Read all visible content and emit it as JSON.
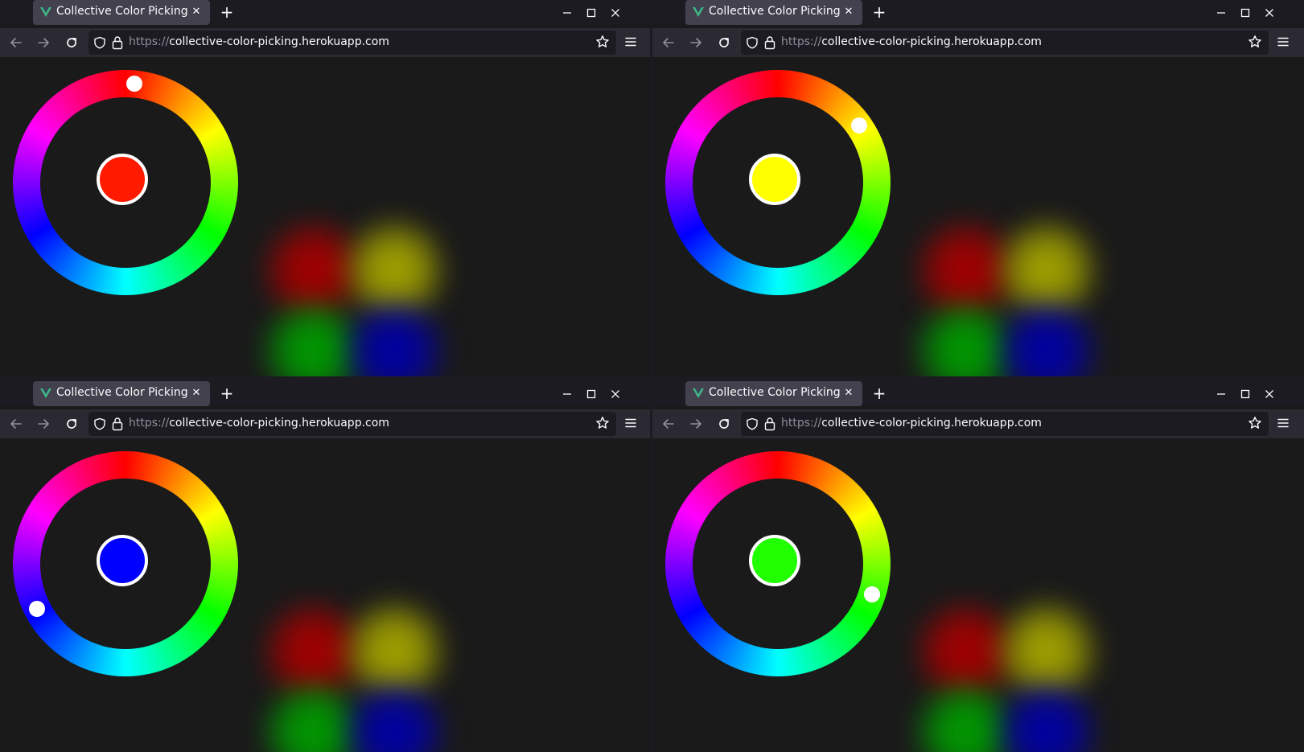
{
  "windows": [
    {
      "tab": {
        "title": "Collective Color Picking",
        "favicon": "vue-logo-icon",
        "close_label": "✕"
      },
      "url": {
        "scheme": "https://",
        "host": "collective-color-picking.herokuapp.com"
      },
      "picker": {
        "selected_color": "#ff1a00",
        "hue_degrees": 5
      }
    },
    {
      "tab": {
        "title": "Collective Color Picking",
        "favicon": "vue-logo-icon",
        "close_label": "✕"
      },
      "url": {
        "scheme": "https://",
        "host": "collective-color-picking.herokuapp.com"
      },
      "picker": {
        "selected_color": "#ffff00",
        "hue_degrees": 55
      }
    },
    {
      "tab": {
        "title": "Collective Color Picking",
        "favicon": "vue-logo-icon",
        "close_label": "✕"
      },
      "url": {
        "scheme": "https://",
        "host": "collective-color-picking.herokuapp.com"
      },
      "picker": {
        "selected_color": "#0000ff",
        "hue_degrees": 243
      }
    },
    {
      "tab": {
        "title": "Collective Color Picking",
        "favicon": "vue-logo-icon",
        "close_label": "✕"
      },
      "url": {
        "scheme": "https://",
        "host": "collective-color-picking.herokuapp.com"
      },
      "picker": {
        "selected_color": "#22ff00",
        "hue_degrees": 108
      }
    }
  ],
  "browser_chrome": {
    "new_tab_label": "+",
    "icons": [
      "back-arrow-icon",
      "forward-arrow-icon",
      "reload-icon",
      "shield-icon",
      "lock-icon",
      "star-icon",
      "hamburger-menu-icon",
      "minimize-icon",
      "maximize-icon",
      "close-icon"
    ]
  },
  "collective_colors": [
    {
      "name": "red",
      "color": "#aa0000"
    },
    {
      "name": "yellow",
      "color": "#a8a800"
    },
    {
      "name": "green",
      "color": "#00a000"
    },
    {
      "name": "blue",
      "color": "#0000aa"
    }
  ],
  "colors": {
    "page_background": "#1a1a1a",
    "tabbar_background": "#1c1b22",
    "navbar_background": "#2b2a33",
    "active_tab": "#42414d",
    "vue_green": "#41b883"
  }
}
